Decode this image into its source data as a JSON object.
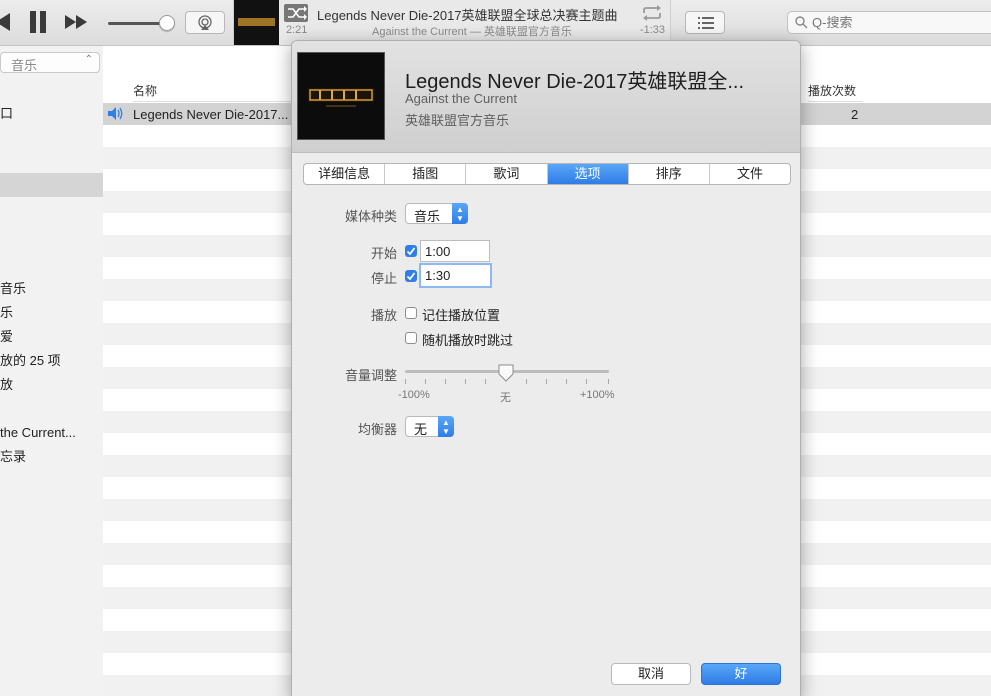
{
  "toolbar": {
    "now_playing_title": "Legends Never Die-2017英雄联盟全球总决赛主题曲",
    "now_playing_subtitle": "Against the Current — 英雄联盟官方音乐",
    "elapsed": "2:21",
    "remaining": "-1:33",
    "volume_level": 0.9,
    "search_placeholder": "Q-搜索"
  },
  "sidebar": {
    "source_select": "音乐",
    "items": [
      {
        "label": "口"
      },
      {
        "label": ""
      },
      {
        "label": ""
      },
      {
        "label": ""
      },
      {
        "label": ""
      },
      {
        "label": ""
      },
      {
        "label": ""
      },
      {
        "label": ""
      },
      {
        "label": "音乐"
      },
      {
        "label": "乐"
      },
      {
        "label": "爱"
      },
      {
        "label": "放的 25 项"
      },
      {
        "label": "放"
      },
      {
        "label": ""
      },
      {
        "label": "the Current..."
      },
      {
        "label": "忘录"
      }
    ]
  },
  "table": {
    "col_name": "名称",
    "col_plays": "播放次数",
    "playing_row": {
      "name": "Legends Never Die-2017...",
      "plays": "2"
    }
  },
  "dialog": {
    "title": "Legends Never Die-2017英雄联盟全...",
    "artist": "Against the Current",
    "album": "英雄联盟官方音乐",
    "tabs": [
      "详细信息",
      "插图",
      "歌词",
      "选项",
      "排序",
      "文件"
    ],
    "active_tab": "选项",
    "media_kind_label": "媒体种类",
    "media_kind_value": "音乐",
    "start_label": "开始",
    "start_value": "1:00",
    "stop_label": "停止",
    "stop_value": "1:30",
    "playback_label": "播放",
    "remember_position": "记住播放位置",
    "skip_shuffle": "随机播放时跳过",
    "volume_label": "音量调整",
    "volume_min": "-100%",
    "volume_mid": "无",
    "volume_max": "+100%",
    "volume_adjust_value": "0%",
    "equalizer_label": "均衡器",
    "equalizer_value": "无",
    "cancel_label": "取消",
    "ok_label": "好"
  },
  "colors": {
    "accent": "#2e7de6",
    "selected_row": "#d3d3d3"
  }
}
